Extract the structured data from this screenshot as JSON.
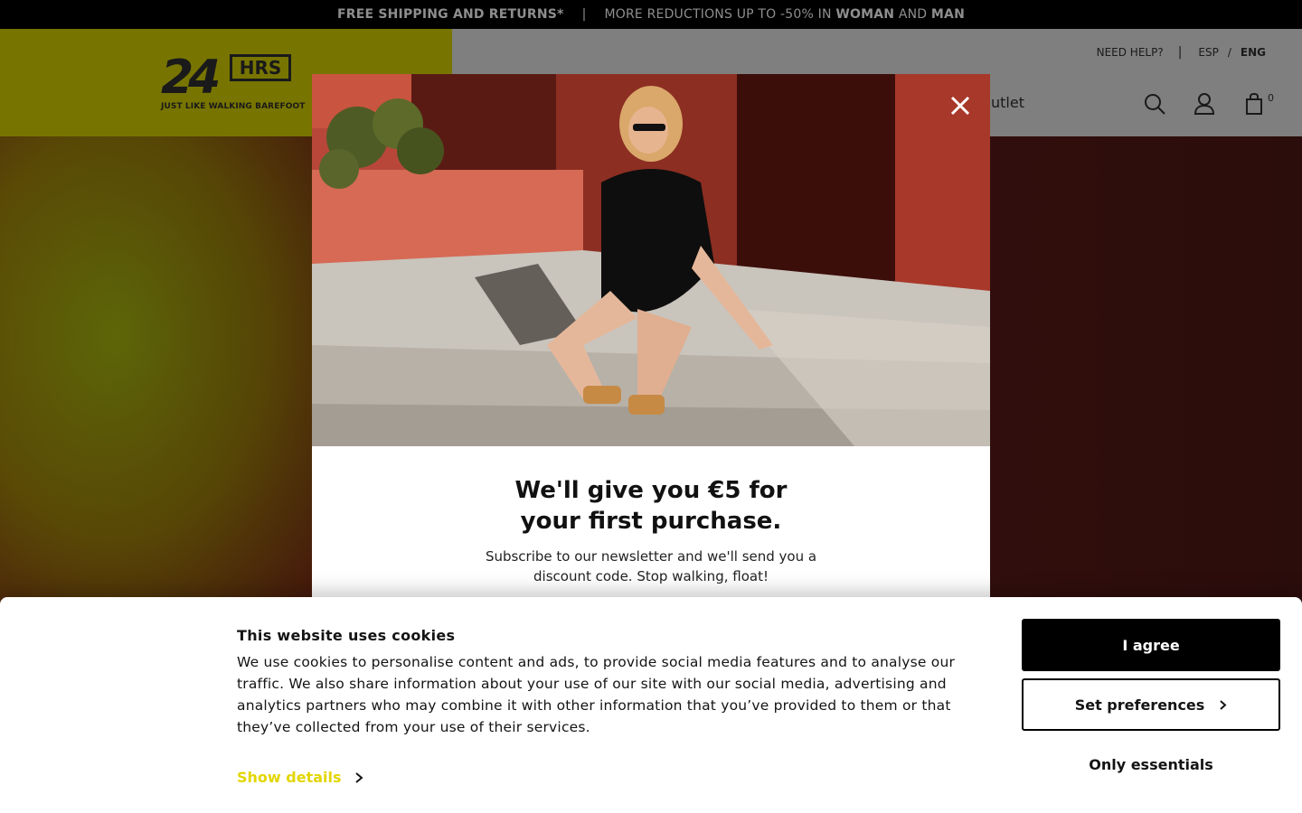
{
  "announcement": {
    "part1": "FREE SHIPPING AND RETURNS*",
    "separator": "|",
    "part2_prefix": "MORE REDUCTIONS UP TO -50% IN",
    "woman": "WOMAN",
    "and": "AND",
    "man": "MAN"
  },
  "header": {
    "logo": {
      "number": "24",
      "hrs": "HRS",
      "tagline": "JUST LIKE WALKING BAREFOOT"
    },
    "utility": {
      "help": "NEED HELP?",
      "pipe": "|",
      "lang_esp": "ESP",
      "lang_sep": "/",
      "lang_eng": "ENG"
    },
    "nav_outlet": "utlet",
    "cart_count": "0",
    "icons": [
      "search-icon",
      "user-icon",
      "shopping-bag-icon"
    ]
  },
  "modal": {
    "title_line1": "We'll give you €5 for",
    "title_line2": "your first purchase.",
    "text_line1": "Subscribe to our newsletter and we'll send you a",
    "text_line2": "discount code. Stop walking, float!"
  },
  "cookie_banner": {
    "title": "This website uses cookies",
    "body": "We use cookies to personalise content and ads, to provide social media features and to analyse our traffic. We also share information about your use of our site with our social media, advertising and analytics partners who may combine it with other information that you’ve provided to them or that they’ve collected from your use of their services.",
    "show_details": "Show details",
    "agree": "I agree",
    "preferences": "Set preferences",
    "essentials": "Only essentials"
  },
  "colors": {
    "brand_yellow": "#e3d600",
    "header_yellow_dimmed": "#777500",
    "black": "#000000"
  }
}
